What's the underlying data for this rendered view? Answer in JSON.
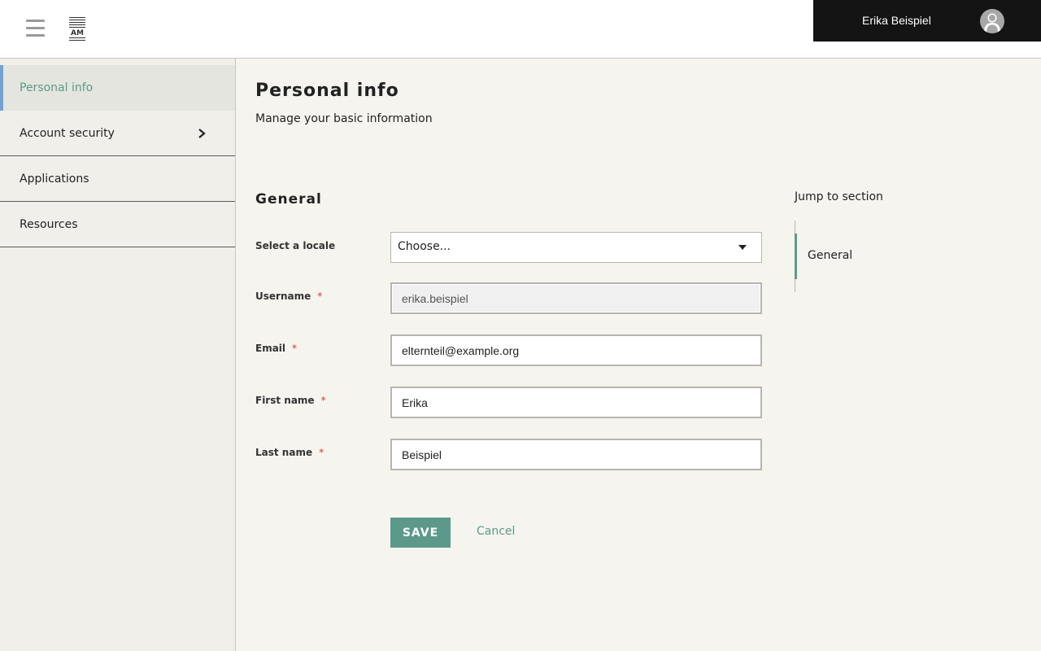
{
  "header": {
    "user_name": "Erika Beispiel",
    "logo_text": "FREIE SCHULE AM BERG"
  },
  "sidebar": {
    "items": [
      {
        "label": "Personal info",
        "active": true
      },
      {
        "label": "Account security",
        "has_submenu": true
      },
      {
        "label": "Applications"
      },
      {
        "label": "Resources"
      }
    ]
  },
  "main": {
    "title": "Personal info",
    "subtitle": "Manage your basic information",
    "section_title": "General",
    "fields": {
      "locale": {
        "label": "Select a locale",
        "value": "Choose..."
      },
      "username": {
        "label": "Username",
        "value": "erika.beispiel",
        "required_mark": "*"
      },
      "email": {
        "label": "Email",
        "value": "elternteil@example.org",
        "required_mark": "*"
      },
      "first_name": {
        "label": "First name",
        "value": "Erika",
        "required_mark": "*"
      },
      "last_name": {
        "label": "Last name",
        "value": "Beispiel",
        "required_mark": "*"
      }
    },
    "save_label": "SAVE",
    "cancel_label": "Cancel"
  },
  "jump": {
    "title": "Jump to section",
    "items": [
      "General"
    ]
  },
  "colors": {
    "accent": "#5b9a8b",
    "active_indicator": "#6fa3d8",
    "header_user_bg": "#141414",
    "page_bg": "#f5f4ef"
  },
  "icons": {
    "menu": "hamburger-icon",
    "user": "user-avatar-icon",
    "submenu": "chevron-right-icon",
    "dropdown": "caret-down-icon"
  }
}
